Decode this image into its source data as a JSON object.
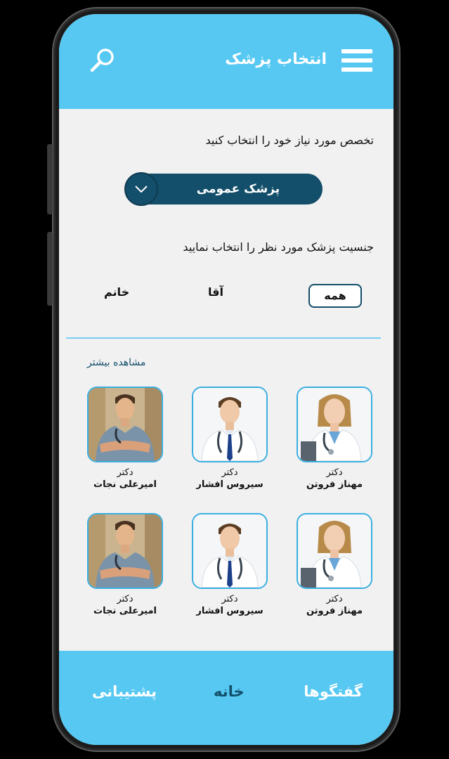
{
  "header": {
    "title": "انتخاب پزشک",
    "menu_icon": "hamburger-menu-icon",
    "search_icon": "search-icon"
  },
  "specialty": {
    "prompt": "تخصص مورد نیاز خود را انتخاب کنید",
    "selected": "پزشک عمومی"
  },
  "gender": {
    "prompt": "جنسیت پزشک مورد نظر را انتخاب نمایید",
    "options": [
      "همه",
      "آقا",
      "خانم"
    ],
    "selected": "همه"
  },
  "see_more": "مشاهده بیشتر",
  "doctors": [
    {
      "title": "دکتر",
      "name": "مهناز فروتن"
    },
    {
      "title": "دکتر",
      "name": "سیروس افشار"
    },
    {
      "title": "دکتر",
      "name": "امیرعلی نجات"
    },
    {
      "title": "دکتر",
      "name": "مهناز فروتن"
    },
    {
      "title": "دکتر",
      "name": "سیروس افشار"
    },
    {
      "title": "دکتر",
      "name": "امیرعلی نجات"
    }
  ],
  "nav": {
    "chats": "گفتگوها",
    "home": "خانه",
    "support": "پشتیبانی"
  },
  "colors": {
    "accent": "#56c8f2",
    "primary_dark": "#134e6a",
    "background": "#f1f1f2"
  }
}
